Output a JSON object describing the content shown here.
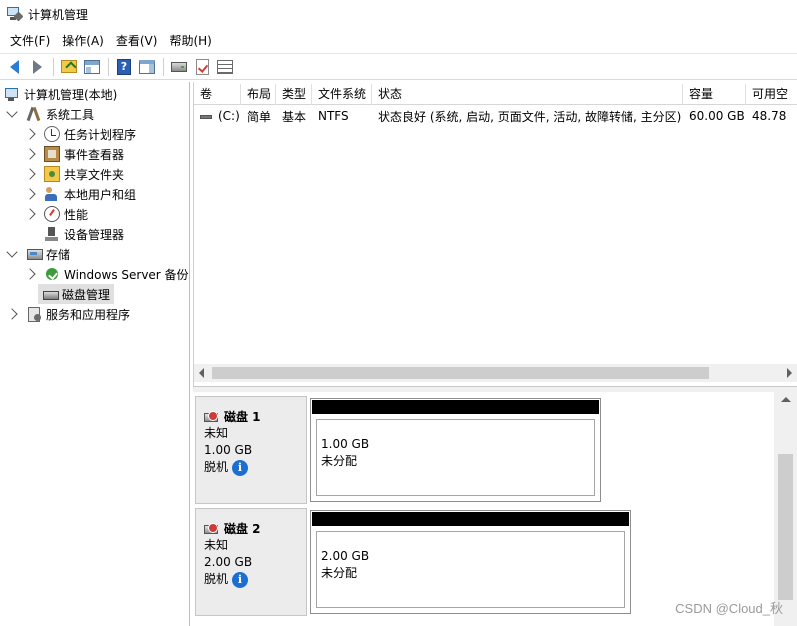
{
  "window": {
    "title": "计算机管理"
  },
  "menu": [
    "文件(F)",
    "操作(A)",
    "查看(V)",
    "帮助(H)"
  ],
  "toolbar": {
    "icons": [
      "back-arrow-icon",
      "forward-arrow-icon",
      "up-folder-icon",
      "show-tree-icon",
      "help-icon",
      "show-action-pane-icon",
      "drive-icon",
      "checklist-icon",
      "properties-icon"
    ]
  },
  "tree": {
    "root": "计算机管理(本地)",
    "system_tools": "系统工具",
    "task_scheduler": "任务计划程序",
    "event_viewer": "事件查看器",
    "shared_folders": "共享文件夹",
    "local_users": "本地用户和组",
    "performance": "性能",
    "device_manager": "设备管理器",
    "storage": "存储",
    "windows_backup": "Windows Server 备份",
    "disk_management": "磁盘管理",
    "services_apps": "服务和应用程序"
  },
  "volume_list": {
    "columns": [
      "卷",
      "布局",
      "类型",
      "文件系统",
      "状态",
      "容量",
      "可用空"
    ],
    "rows": [
      {
        "volume": "(C:)",
        "layout": "简单",
        "type": "基本",
        "fs": "NTFS",
        "status": "状态良好 (系统, 启动, 页面文件, 活动, 故障转储, 主分区)",
        "capacity": "60.00 GB",
        "free": "48.78"
      }
    ]
  },
  "disks": [
    {
      "name": "磁盘 1",
      "type": "未知",
      "size": "1.00 GB",
      "state": "脱机",
      "partition_size": "1.00 GB",
      "partition_status": "未分配"
    },
    {
      "name": "磁盘 2",
      "type": "未知",
      "size": "2.00 GB",
      "state": "脱机",
      "partition_size": "2.00 GB",
      "partition_status": "未分配"
    }
  ],
  "watermark": "CSDN @Cloud_秋",
  "colors": {
    "accent": "#1c6fd1",
    "partition_header": "#000000",
    "selection": "#e0e0e0"
  }
}
